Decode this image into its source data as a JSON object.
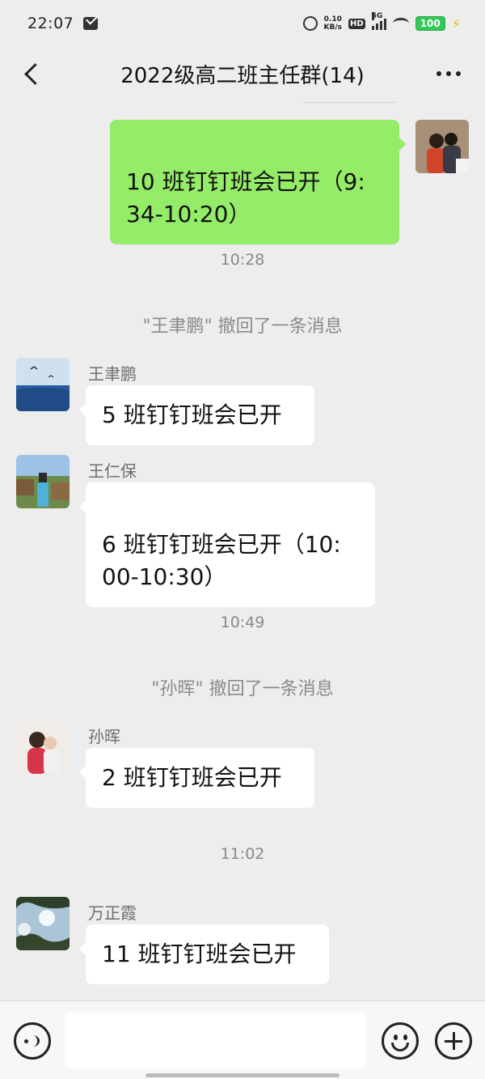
{
  "status_bar": {
    "time": "22:07",
    "net_speed_value": "0.10",
    "net_speed_unit": "KB/s",
    "hd_label": "HD",
    "network_label": "5G",
    "battery": "100"
  },
  "header": {
    "title": "2022级高二班主任群(14)"
  },
  "messages": {
    "m1_text": "10 班钉钉班会已开（9:\n34-10:20）",
    "t1": "10:28",
    "sys1": "\"王聿鹏\" 撤回了一条消息",
    "m2_sender": "王聿鹏",
    "m2_text": "5 班钉钉班会已开",
    "m3_sender": "王仁保",
    "m3_text": "6 班钉钉班会已开（10:\n00-10:30）",
    "t2": "10:49",
    "sys2": "\"孙晖\" 撤回了一条消息",
    "m4_sender": "孙晖",
    "m4_text": "2 班钉钉班会已开",
    "t3": "11:02",
    "m5_sender": "万正霞",
    "m5_text": "11 班钉钉班会已开"
  },
  "colors": {
    "background": "#ededed",
    "outgoing_bubble": "#95ec69",
    "incoming_bubble": "#ffffff"
  }
}
